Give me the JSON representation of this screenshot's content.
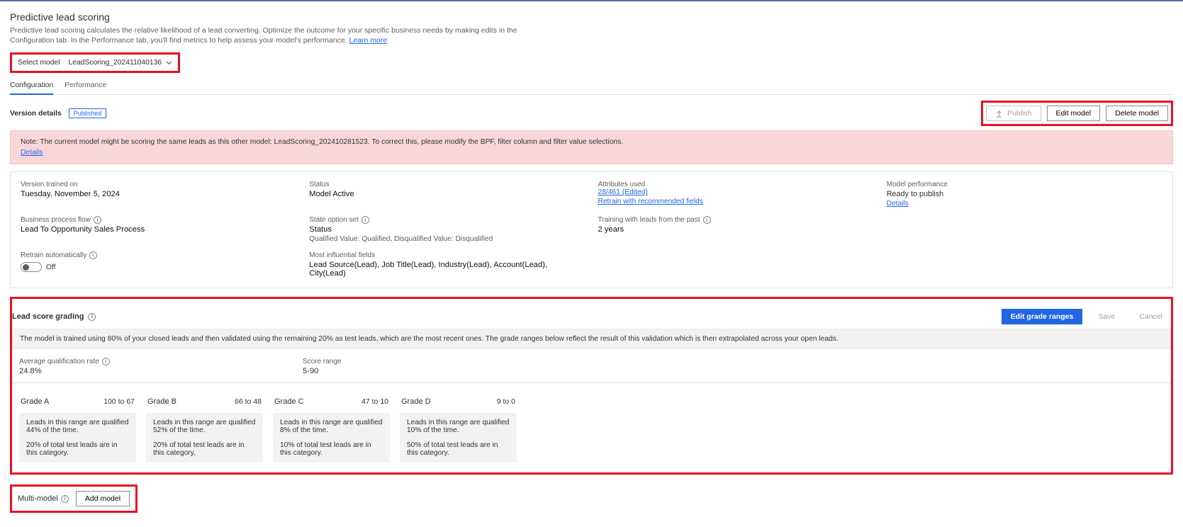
{
  "header": {
    "title": "Predictive lead scoring",
    "subtitle_pre": "Predictive lead scoring calculates the relative likelihood of a lead converting. Optimize the outcome for your specific business needs by making edits in the Configuration tab. In the Performance tab, you'll find metrics to help assess your model's performance. ",
    "learn_more": "Learn more"
  },
  "select_model": {
    "label": "Select model",
    "value": "LeadScoring_202411040136"
  },
  "tabs": {
    "config": "Configuration",
    "performance": "Performance"
  },
  "version_details": {
    "label": "Version details",
    "badge": "Published",
    "buttons": {
      "publish": "Publish",
      "edit": "Edit model",
      "delete": "Delete model"
    }
  },
  "warning": {
    "text": "Note: The current model might be scoring the same leads as this other model: LeadScoring_202410281523. To correct this, please modify the BPF, filter column and filter value selections.",
    "details": "Details"
  },
  "summary": {
    "trained_on": {
      "label": "Version trained on",
      "value": "Tuesday, November 5, 2024"
    },
    "status": {
      "label": "Status",
      "value": "Model Active"
    },
    "attributes": {
      "label": "Attributes used",
      "value": "28/461 (Edited)",
      "link": "Retrain with recommended fields"
    },
    "performance": {
      "label": "Model performance",
      "value": "Ready to publish",
      "details": "Details"
    },
    "bpf": {
      "label": "Business process flow",
      "value": "Lead To Opportunity Sales Process"
    },
    "state_option": {
      "label": "State option set",
      "value": "Status",
      "sub": "Qualified Value: Qualified, Disqualified Value: Disqualified"
    },
    "training_past": {
      "label": "Training with leads from the past",
      "value": "2 years"
    },
    "retrain": {
      "label": "Retrain automatically",
      "state": "Off"
    },
    "influential": {
      "label": "Most influential fields",
      "value": "Lead Source(Lead), Job Title(Lead), Industry(Lead), Account(Lead), City(Lead)"
    }
  },
  "grading": {
    "section_label": "Lead score grading",
    "buttons": {
      "edit": "Edit grade ranges",
      "save": "Save",
      "cancel": "Cancel"
    },
    "info": "The model is trained using 80% of your closed leads and then validated using the remaining 20% as test leads, which are the most recent ones. The grade ranges below reflect the result of this validation which is then extrapolated across your open leads.",
    "avg_q_label": "Average qualification rate",
    "avg_q_value": "24.8%",
    "score_range_label": "Score range",
    "score_range_value": "5-90",
    "grades": [
      {
        "name": "Grade A",
        "range": "100 to 67",
        "line1": "Leads in this range are qualified 44% of the time.",
        "line2": "20% of total test leads are in this category."
      },
      {
        "name": "Grade B",
        "range": "66 to 48",
        "line1": "Leads in this range are qualified 52% of the time.",
        "line2": "20% of total test leads are in this category."
      },
      {
        "name": "Grade C",
        "range": "47 to 10",
        "line1": "Leads in this range are qualified 8% of the time.",
        "line2": "10% of total test leads are in this category."
      },
      {
        "name": "Grade D",
        "range": "9 to 0",
        "line1": "Leads in this range are qualified 10% of the time.",
        "line2": "50% of total test leads are in this category."
      }
    ]
  },
  "multi_model": {
    "label": "Multi-model",
    "button": "Add model"
  }
}
